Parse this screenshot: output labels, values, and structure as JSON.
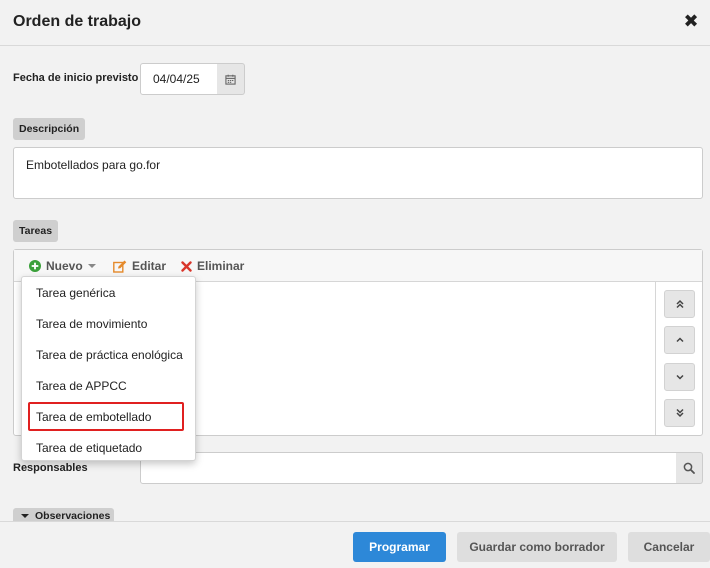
{
  "dialog": {
    "title": "Orden de trabajo",
    "close_icon": "close-icon"
  },
  "schedule": {
    "start_label": "Fecha de inicio previsto",
    "start_value": "04/04/25",
    "calendar_icon": "calendar-icon"
  },
  "description": {
    "label": "Descripción",
    "value": "Embotellados para go.for"
  },
  "tasks": {
    "label": "Tareas",
    "toolbar": {
      "new_label": "Nuevo",
      "edit_label": "Editar",
      "delete_label": "Eliminar"
    },
    "new_menu": [
      "Tarea genérica",
      "Tarea de movimiento",
      "Tarea de práctica enológica",
      "Tarea de APPCC",
      "Tarea de embotellado",
      "Tarea de etiquetado"
    ],
    "highlighted_option": "Tarea de embotellado",
    "reorder_icons": [
      "double-chevron-up-icon",
      "chevron-up-icon",
      "chevron-down-icon",
      "double-chevron-down-icon"
    ]
  },
  "responsables": {
    "label": "Responsables",
    "value": "",
    "search_icon": "search-icon"
  },
  "observations": {
    "label": "Observaciones"
  },
  "footer": {
    "schedule_label": "Programar",
    "draft_label": "Guardar como borrador",
    "cancel_label": "Cancelar"
  },
  "colors": {
    "primary": "#2d88d8",
    "highlight": "#e02020",
    "add_green": "#3aa03a",
    "edit_orange": "#e58a2b",
    "delete_red": "#d9362b"
  }
}
